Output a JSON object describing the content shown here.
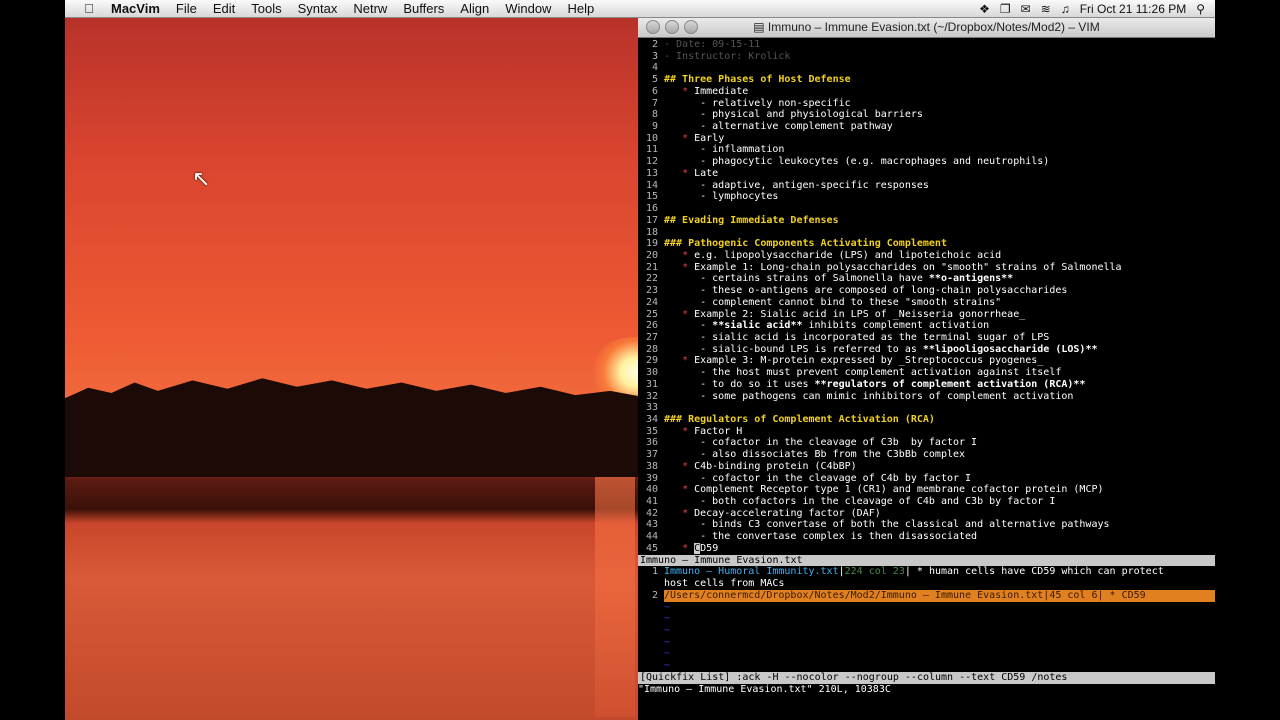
{
  "menubar": {
    "app_name": "MacVim",
    "items": [
      "File",
      "Edit",
      "Tools",
      "Syntax",
      "Netrw",
      "Buffers",
      "Align",
      "Window",
      "Help"
    ],
    "clock": "Fri Oct 21  11:26 PM"
  },
  "window": {
    "title": "Immuno – Immune Evasion.txt (~/Dropbox/Notes/Mod2) – VIM"
  },
  "editor": {
    "lines": [
      {
        "n": "2",
        "t": "- Date: 09-15-11",
        "s": "dim"
      },
      {
        "n": "3",
        "t": "- Instructor: Krolick",
        "s": "dim"
      },
      {
        "n": "4",
        "t": "",
        "s": "plain"
      },
      {
        "n": "5",
        "t": "## Three Phases of Host Defense",
        "s": "hdr"
      },
      {
        "n": "6",
        "t": "   * Immediate",
        "s": "bullet"
      },
      {
        "n": "7",
        "t": "      - relatively non-specific",
        "s": "plain"
      },
      {
        "n": "8",
        "t": "      - physical and physiological barriers",
        "s": "plain"
      },
      {
        "n": "9",
        "t": "      - alternative complement pathway",
        "s": "plain"
      },
      {
        "n": "10",
        "t": "   * Early",
        "s": "bullet"
      },
      {
        "n": "11",
        "t": "      - inflammation",
        "s": "plain"
      },
      {
        "n": "12",
        "t": "      - phagocytic leukocytes (e.g. macrophages and neutrophils)",
        "s": "plain"
      },
      {
        "n": "13",
        "t": "   * Late",
        "s": "bullet"
      },
      {
        "n": "14",
        "t": "      - adaptive, antigen-specific responses",
        "s": "plain"
      },
      {
        "n": "15",
        "t": "      - lymphocytes",
        "s": "plain"
      },
      {
        "n": "16",
        "t": "",
        "s": "plain"
      },
      {
        "n": "17",
        "t": "## Evading Immediate Defenses",
        "s": "hdr"
      },
      {
        "n": "18",
        "t": "",
        "s": "plain"
      },
      {
        "n": "19",
        "t": "### Pathogenic Components Activating Complement",
        "s": "hdr"
      },
      {
        "n": "20",
        "t": "   * e.g. lipopolysaccharide (LPS) and lipoteichoic acid",
        "s": "bullet"
      },
      {
        "n": "21",
        "t": "   * Example 1: Long-chain polysaccharides on \"smooth\" strains of Salmonella",
        "s": "bullet"
      },
      {
        "n": "22",
        "t": "      - certains strains of Salmonella have **o-antigens**",
        "s": "plain"
      },
      {
        "n": "23",
        "t": "      - these o-antigens are composed of long-chain polysaccharides",
        "s": "plain"
      },
      {
        "n": "24",
        "t": "      - complement cannot bind to these \"smooth strains\"",
        "s": "plain"
      },
      {
        "n": "25",
        "t": "   * Example 2: Sialic acid in LPS of _Neisseria gonorrheae_",
        "s": "bullet"
      },
      {
        "n": "26",
        "t": "      - **sialic acid** inhibits complement activation",
        "s": "plain"
      },
      {
        "n": "27",
        "t": "      - sialic acid is incorporated as the terminal sugar of LPS",
        "s": "plain"
      },
      {
        "n": "28",
        "t": "      - sialic-bound LPS is referred to as **lipooligosaccharide (LOS)**",
        "s": "plain"
      },
      {
        "n": "29",
        "t": "   * Example 3: M-protein expressed by _Streptococcus pyogenes_",
        "s": "bullet"
      },
      {
        "n": "30",
        "t": "      - the host must prevent complement activation against itself",
        "s": "plain"
      },
      {
        "n": "31",
        "t": "      - to do so it uses **regulators of complement activation (RCA)**",
        "s": "plain"
      },
      {
        "n": "32",
        "t": "      - some pathogens can mimic inhibitors of complement activation",
        "s": "plain"
      },
      {
        "n": "33",
        "t": "",
        "s": "plain"
      },
      {
        "n": "34",
        "t": "### Regulators of Complement Activation (RCA)",
        "s": "hdr"
      },
      {
        "n": "35",
        "t": "   * Factor H",
        "s": "bullet"
      },
      {
        "n": "36",
        "t": "      - cofactor in the cleavage of C3b  by factor I",
        "s": "plain"
      },
      {
        "n": "37",
        "t": "      - also dissociates Bb from the C3bBb complex",
        "s": "plain"
      },
      {
        "n": "38",
        "t": "   * C4b-binding protein (C4bBP)",
        "s": "bullet"
      },
      {
        "n": "39",
        "t": "      - cofactor in the cleavage of C4b by factor I",
        "s": "plain"
      },
      {
        "n": "40",
        "t": "   * Complement Receptor type 1 (CR1) and membrane cofactor protein (MCP)",
        "s": "bullet"
      },
      {
        "n": "41",
        "t": "      - both cofactors in the cleavage of C4b and C3b by factor I",
        "s": "plain"
      },
      {
        "n": "42",
        "t": "   * Decay-accelerating factor (DAF)",
        "s": "bullet"
      },
      {
        "n": "43",
        "t": "      - binds C3 convertase of both the classical and alternative pathways",
        "s": "plain"
      },
      {
        "n": "44",
        "t": "      - the convertase complex is then disassociated",
        "s": "plain"
      },
      {
        "n": "45",
        "t": "   * CD59",
        "s": "bullet"
      }
    ],
    "status_line": "Immuno – Immune Evasion.txt"
  },
  "quickfix": {
    "entries": [
      {
        "n": "1",
        "file": "Immuno – Humoral Immunity.txt",
        "pos": "224 col 23",
        "text": " * human cells have CD59 which can protect"
      },
      {
        "n": "",
        "file": "",
        "pos": "",
        "text": "host cells from MACs"
      },
      {
        "n": "2",
        "file": "/Users/connermcd/Dropbox/Notes/Mod2/Immuno – Immune Evasion.txt",
        "pos": "45 col 6",
        "text": " * CD59"
      }
    ],
    "empty_lines": 6,
    "status_line": "[Quickfix List] :ack -H --nocolor --nogroup --column --text CD59 /notes",
    "command_line": "\"Immuno – Immune Evasion.txt\" 210L, 10383C"
  }
}
